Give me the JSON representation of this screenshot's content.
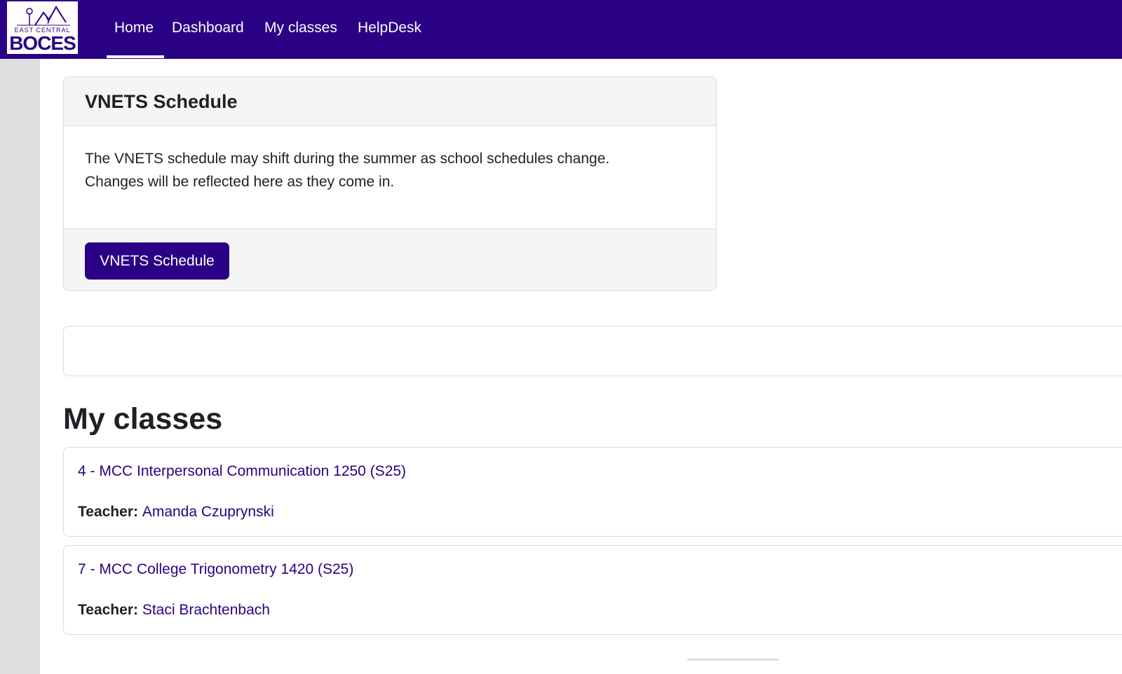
{
  "logo": {
    "line1": "EAST CENTRAL",
    "line2": "BOCES"
  },
  "nav": {
    "items": [
      "Home",
      "Dashboard",
      "My classes",
      "HelpDesk"
    ],
    "active": "Home"
  },
  "vnets": {
    "title": "VNETS Schedule",
    "body_line1": "The VNETS schedule may shift during the summer as school schedules change.",
    "body_line2": "Changes will be reflected here as they come in.",
    "button_label": "VNETS Schedule"
  },
  "my_classes": {
    "heading": "My classes",
    "teacher_label": "Teacher:",
    "classes": [
      {
        "name": "4 - MCC Interpersonal Communication 1250 (S25)",
        "teacher": "Amanda Czuprynski"
      },
      {
        "name": "7 - MCC College Trigonometry 1420 (S25)",
        "teacher": "Staci Brachtenbach"
      }
    ]
  },
  "colors": {
    "brand": "#2a0185",
    "link": "#2a0185",
    "sidebar": "#dedede",
    "card_header": "#f5f5f5"
  }
}
